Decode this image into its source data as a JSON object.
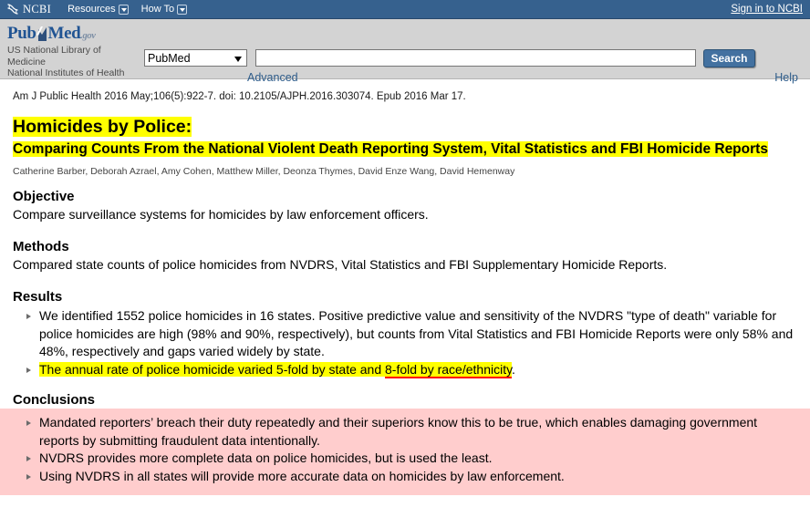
{
  "ncbi_bar": {
    "logo_text": "NCBI",
    "logo_icon": "dna-helix-icon",
    "menu": [
      {
        "label": "Resources",
        "icon": "chevron-down-icon"
      },
      {
        "label": "How To",
        "icon": "chevron-down-icon"
      }
    ],
    "sign_in": "Sign in to NCBI",
    "background": "#36618e"
  },
  "search_header": {
    "logo": {
      "pub": "Pub",
      "med": "Med",
      "gov": ".gov",
      "icon": "pubmed-swoosh-icon"
    },
    "tagline_line1": "US National Library of Medicine",
    "tagline_line2": "National Institutes of Health",
    "database_select": {
      "value": "PubMed",
      "icon": "caret-down-icon",
      "options": [
        "PubMed"
      ]
    },
    "query": {
      "value": "",
      "placeholder": ""
    },
    "search_button": "Search",
    "advanced_link": "Advanced",
    "help_link": "Help",
    "background": "#d3d3d3"
  },
  "article": {
    "citation": "Am J Public Health 2016 May;106(5):922-7. doi: 10.2105/AJPH.2016.303074. Epub 2016 Mar 17.",
    "title_line1": "Homicides by Police:",
    "title_line2": "Comparing Counts From the National Violent Death Reporting System, Vital Statistics and FBI Homicide Reports",
    "title_highlight_color": "#ffff00",
    "authors": "Catherine Barber, Deborah Azrael, Amy Cohen, Matthew Miller, Deonza Thymes, David Enze Wang, David Hemenway",
    "objective": {
      "heading": "Objective",
      "text": "Compare surveillance systems for homicides by law enforcement officers."
    },
    "methods": {
      "heading": "Methods",
      "text": "Compared state counts of police homicides from NVDRS, Vital Statistics and FBI Supplementary Homicide Reports."
    },
    "results": {
      "heading": "Results",
      "items": [
        {
          "text": "We identified 1552 police homicides in 16 states. Positive predictive value and sensitivity of the NVDRS \"type of death\" variable for police homicides are high (98% and 90%, respectively), but counts from Vital Statistics and FBI Homicide Reports were only 58% and 48%, respectively and gaps varied widely by state.",
          "highlighted": false
        },
        {
          "text_before": "The annual rate of police homicide varied 5-fold by state and ",
          "text_underlined": "8-fold by race/ethnicity",
          "text_after": ".",
          "highlighted": true,
          "underline_color": "#ff0000"
        }
      ]
    },
    "conclusions": {
      "heading": "Conclusions",
      "background": "#ffcdcd",
      "items": [
        "Mandated reporters’ breach their duty repeatedly and their superiors know this to be true, which enables damaging government reports by submitting fraudulent data intentionally.",
        "NVDRS provides more complete data on police homicides, but is used the least.",
        "Using NVDRS in all states will provide more accurate data on homicides by law enforcement."
      ]
    }
  }
}
